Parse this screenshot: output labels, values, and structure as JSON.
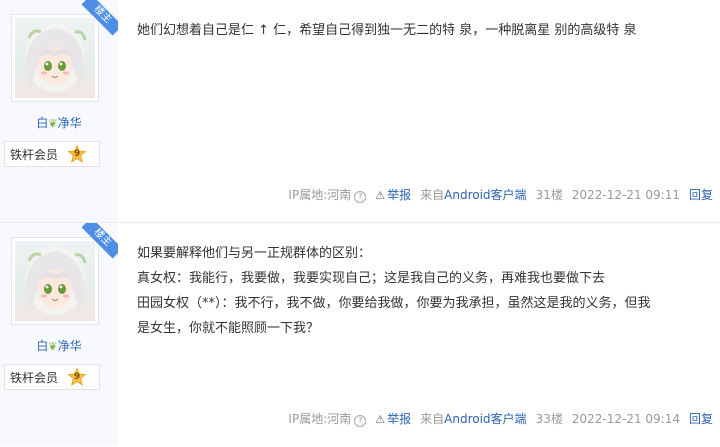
{
  "posts": [
    {
      "corner_tag": "楼主",
      "username": "白",
      "username_tail": "净华",
      "badge_label": "铁杆会员",
      "level": "9",
      "lines": [
        "她们幻想着自己是仁 ↑ 仁，希望自己得到独一无二的特 泉，一种脱离星 别的高级特 泉"
      ],
      "ip_label": "IP属地:河南",
      "help": "?",
      "report": "举报",
      "client_prefix": "来自",
      "client": "Android客户端",
      "floor": "31楼",
      "time": "2022-12-21 09:11",
      "reply": "回复"
    },
    {
      "corner_tag": "楼主",
      "username": "白",
      "username_tail": "净华",
      "badge_label": "铁杆会员",
      "level": "9",
      "lines": [
        "如果要解释他们与另一正规群体的区别：",
        "真女权：我能行，我要做，我要实现自己；这是我自己的义务，再难我也要做下去",
        "田园女权（**）：我不行，我不做，你要给我做，你要为我承担，虽然这是我的义务，但我",
        "是女生，你就不能照顾一下我？"
      ],
      "ip_label": "IP属地:河南",
      "help": "?",
      "report": "举报",
      "client_prefix": "来自",
      "client": "Android客户端",
      "floor": "33楼",
      "time": "2022-12-21 09:14",
      "reply": "回复"
    }
  ]
}
